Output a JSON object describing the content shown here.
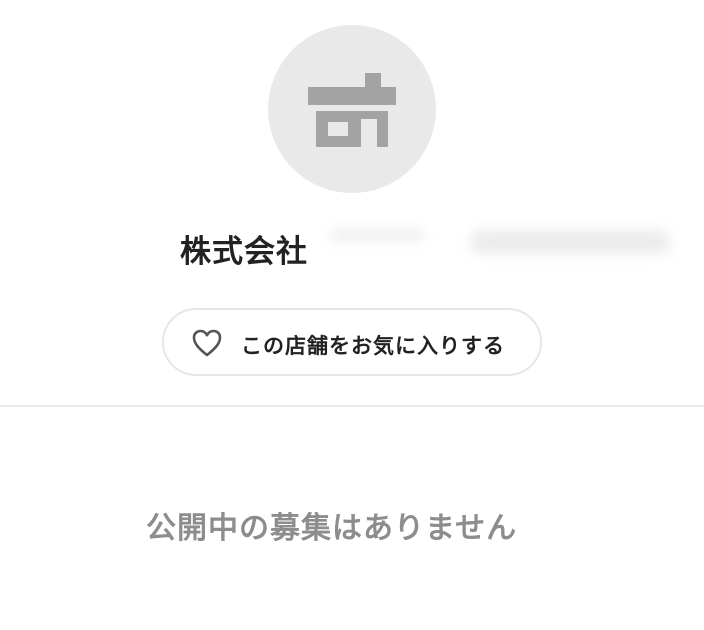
{
  "shop": {
    "avatar_icon": "shop-building-icon",
    "name": "株式会社"
  },
  "favorite": {
    "icon": "heart-outline-icon",
    "label": "この店舗をお気に入りする"
  },
  "jobs": {
    "empty_message": "公開中の募集はありません"
  },
  "colors": {
    "avatar_bg": "#e9e9e9",
    "icon_gray": "#a3a3a3",
    "text_dark": "#222222",
    "text_muted": "#8d8d8d",
    "border": "#e6e6e6"
  }
}
